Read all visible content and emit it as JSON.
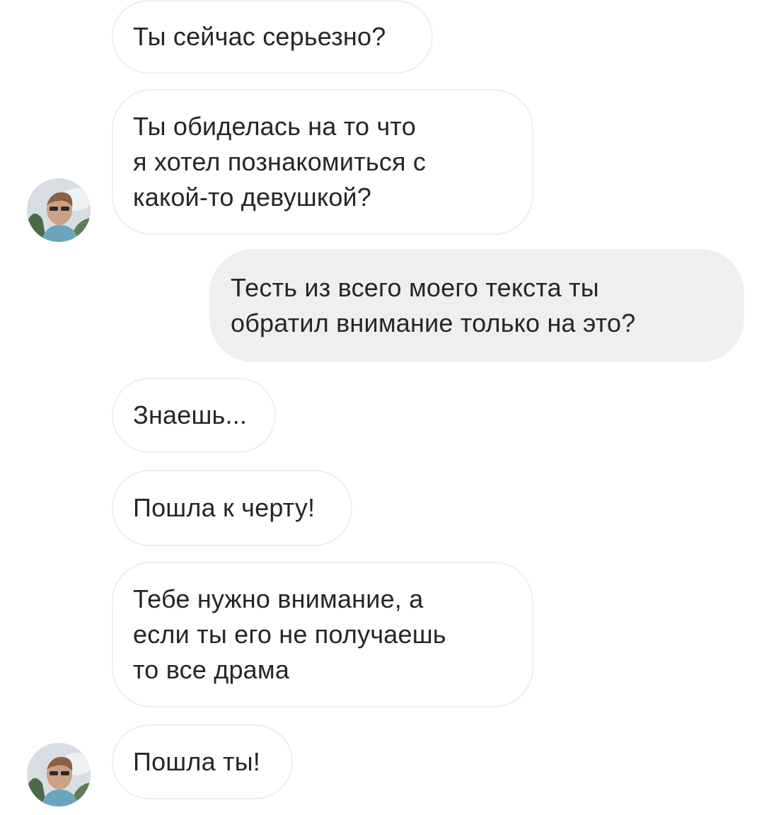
{
  "messages": [
    {
      "sender": "them",
      "text": "Ты сейчас серьезно?"
    },
    {
      "sender": "them",
      "text": "Ты обиделась на то что\nя хотел познакомиться с\nкакой-то девушкой?"
    },
    {
      "sender": "me",
      "text": "Тесть из всего моего текста ты\nобратил внимание только на это?"
    },
    {
      "sender": "them",
      "text": "Знаешь..."
    },
    {
      "sender": "them",
      "text": "Пошла к черту!"
    },
    {
      "sender": "them",
      "text": "Тебе нужно внимание, а\nесли ты его не получаешь\nто все драма"
    },
    {
      "sender": "them",
      "text": "Пошла ты!"
    }
  ],
  "colors": {
    "incoming_bubble_bg": "#ffffff",
    "incoming_bubble_border": "#efefef",
    "outgoing_bubble_bg": "#efefef",
    "text": "#262626"
  },
  "avatar": {
    "icon": "profile-photo-avatar"
  }
}
